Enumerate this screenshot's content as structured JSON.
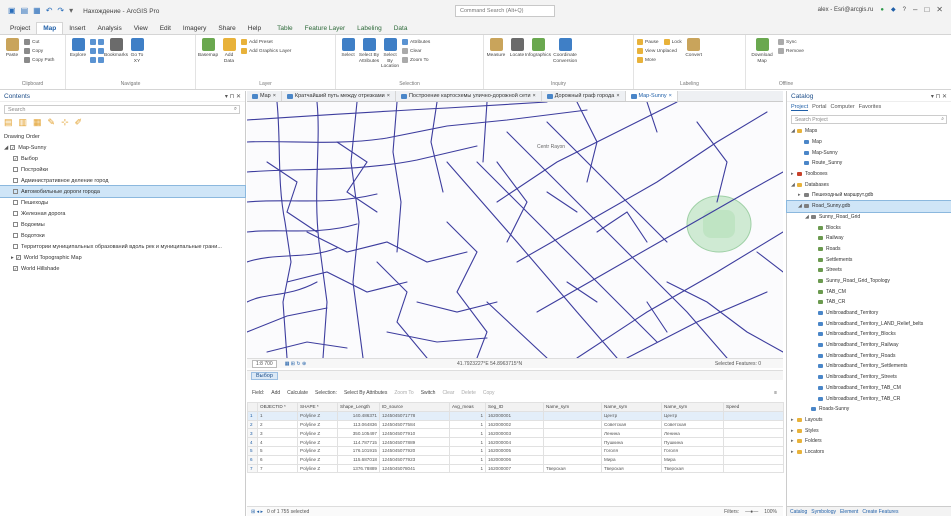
{
  "title_bar": {
    "app_title": "Нахождение - ArcGIS Pro",
    "command_search_placeholder": "Command Search (Alt+Q)",
    "user": "alex - Esri@arcgis.ru",
    "qat_icons": [
      "new-icon",
      "open-icon",
      "save-icon",
      "undo-icon",
      "redo-icon"
    ]
  },
  "ribbon_tabs": [
    {
      "label": "Project",
      "active": false,
      "contextual": false
    },
    {
      "label": "Map",
      "active": true,
      "contextual": false
    },
    {
      "label": "Insert",
      "active": false,
      "contextual": false
    },
    {
      "label": "Analysis",
      "active": false,
      "contextual": false
    },
    {
      "label": "View",
      "active": false,
      "contextual": false
    },
    {
      "label": "Edit",
      "active": false,
      "contextual": false
    },
    {
      "label": "Imagery",
      "active": false,
      "contextual": false
    },
    {
      "label": "Share",
      "active": false,
      "contextual": false
    },
    {
      "label": "Help",
      "active": false,
      "contextual": false
    },
    {
      "label": "Table",
      "active": false,
      "contextual": true
    },
    {
      "label": "Feature Layer",
      "active": false,
      "contextual": true
    },
    {
      "label": "Labeling",
      "active": false,
      "contextual": true
    },
    {
      "label": "Data",
      "active": false,
      "contextual": true
    }
  ],
  "ribbon": {
    "clipboard": {
      "label": "Clipboard",
      "paste": "Paste",
      "cut": "Cut",
      "copy": "Copy",
      "copy_path": "Copy Path"
    },
    "navigate": {
      "label": "Navigate",
      "explore": "Explore",
      "bookmarks": "Bookmarks",
      "go_to_xy": "Go To XY"
    },
    "layer": {
      "label": "Layer",
      "basemap": "Basemap",
      "add_data": "Add Data",
      "add_preset": "Add Preset",
      "add_graphics": "Add Graphics Layer"
    },
    "selection": {
      "label": "Selection",
      "select": "Select",
      "by_attributes": "Select By Attributes",
      "by_location": "Select By Location",
      "attributes": "Attributes",
      "clear": "Clear",
      "zoom_to": "Zoom To"
    },
    "inquiry": {
      "label": "Inquiry",
      "measure": "Measure",
      "locate": "Locate",
      "infographics": "Infographics",
      "coord_conv": "Coordinate Conversion"
    },
    "labeling": {
      "label": "Labeling",
      "pause": "Pause",
      "lock": "Lock",
      "view_unplaced": "View Unplaced",
      "more": "More",
      "convert": "Convert"
    },
    "offline": {
      "label": "Offline",
      "download_map": "Download Map",
      "sync": "Sync",
      "remove": "Remove"
    }
  },
  "contents": {
    "title": "Contents",
    "search_placeholder": "Search",
    "drawing_order": "Drawing Order",
    "layers": [
      {
        "label": "Map-Sunny",
        "checked": true,
        "indent": 0,
        "expander": "◢",
        "selected": false
      },
      {
        "label": "Выбор",
        "checked": true,
        "indent": 1,
        "expander": "",
        "selected": false
      },
      {
        "label": "Постройки",
        "checked": false,
        "indent": 1,
        "expander": "",
        "selected": false
      },
      {
        "label": "Административное деление город",
        "checked": false,
        "indent": 1,
        "expander": "",
        "selected": false
      },
      {
        "label": "Автомобильные дороги города",
        "checked": false,
        "indent": 1,
        "expander": "",
        "selected": true
      },
      {
        "label": "Пешеходы",
        "checked": false,
        "indent": 1,
        "expander": "",
        "selected": false
      },
      {
        "label": "Железная дорога",
        "checked": false,
        "indent": 1,
        "expander": "",
        "selected": false
      },
      {
        "label": "Водоемы",
        "checked": false,
        "indent": 1,
        "expander": "",
        "selected": false
      },
      {
        "label": "Водотоки",
        "checked": false,
        "indent": 1,
        "expander": "",
        "selected": false
      },
      {
        "label": "Территории муниципальных образований вдоль рек и муниципальные грани...",
        "checked": false,
        "indent": 1,
        "expander": "",
        "selected": false
      },
      {
        "label": "World Topographic Map",
        "checked": true,
        "indent": 1,
        "expander": "▸",
        "selected": false
      },
      {
        "label": "World Hillshade",
        "checked": true,
        "indent": 1,
        "expander": "",
        "selected": false
      }
    ]
  },
  "map_tabs": [
    {
      "label": "Map",
      "active": false
    },
    {
      "label": "Кратчайший путь между отрезками",
      "active": false
    },
    {
      "label": "Построение картосхемы улично-дорожной сети",
      "active": false
    },
    {
      "label": "Дорожный граф города",
      "active": false
    },
    {
      "label": "Map-Sunny",
      "active": true
    }
  ],
  "map": {
    "district_label": "Centr Rayon",
    "scale": "1:8 700",
    "coordinates": "41.7923227°E 54.8963715°N",
    "selected_features": "Selected Features: 0",
    "road_color": "#3d3d9e",
    "stadium_color": "#bfe4c3"
  },
  "attribute_table": {
    "tab_label": "Выбор",
    "toolbar": {
      "field": "Field:",
      "add": "Add",
      "calculate": "Calculate",
      "selection": "Selection:",
      "select_by_attr": "Select By Attributes",
      "zoom_to": "Zoom To",
      "switch": "Switch",
      "clear": "Clear",
      "delete": "Delete",
      "copy": "Copy"
    },
    "columns": [
      "",
      "OBJECTID *",
      "SHAPE *",
      "Shape_Length",
      "ID_source",
      "Avg_meas",
      "Seg_ID",
      "Name_sym",
      "Name_sym",
      "Name_sym",
      "Speed"
    ],
    "rows": [
      [
        "1",
        "1",
        "Polyline Z",
        "140.486371",
        "1245045071778",
        "1",
        "162000001",
        "",
        "Центр",
        "Центр",
        ""
      ],
      [
        "2",
        "2",
        "Polyline Z",
        "113.064836",
        "1245045077584",
        "1",
        "162000002",
        "",
        "Советская",
        "Советская",
        ""
      ],
      [
        "3",
        "3",
        "Polyline Z",
        "350.105497",
        "1245045077910",
        "1",
        "162000003",
        "",
        "Ленина",
        "Ленина",
        ""
      ],
      [
        "4",
        "4",
        "Polyline Z",
        "114.787715",
        "1245045077889",
        "1",
        "162000004",
        "",
        "Пушкина",
        "Пушкина",
        ""
      ],
      [
        "5",
        "5",
        "Polyline Z",
        "176.101915",
        "1245045077920",
        "1",
        "162000005",
        "",
        "Гоголя",
        "Гоголя",
        ""
      ],
      [
        "6",
        "6",
        "Polyline Z",
        "115.687018",
        "1245045077923",
        "1",
        "162000006",
        "",
        "Мира",
        "Мира",
        ""
      ],
      [
        "7",
        "7",
        "Polyline Z",
        "1376.78889",
        "1245045078041",
        "1",
        "162000007",
        "Тверская",
        "Тверская",
        "Тверская",
        ""
      ]
    ],
    "status": "0 of 1 755 selected",
    "filters": "Filters:",
    "zoom_pct": "100%"
  },
  "catalog": {
    "title": "Catalog",
    "tabs": [
      "Project",
      "Portal",
      "Computer",
      "Favorites"
    ],
    "search_placeholder": "Search Project",
    "items": [
      {
        "label": "Maps",
        "indent": 0,
        "expander": "◢",
        "icon": "#e8b23a",
        "selected": false
      },
      {
        "label": "Map",
        "indent": 1,
        "expander": "",
        "icon": "#4a86c8",
        "selected": false
      },
      {
        "label": "Map-Sunny",
        "indent": 1,
        "expander": "",
        "icon": "#4a86c8",
        "selected": false
      },
      {
        "label": "Route_Sunny",
        "indent": 1,
        "expander": "",
        "icon": "#4a86c8",
        "selected": false
      },
      {
        "label": "Toolboxes",
        "indent": 0,
        "expander": "▸",
        "icon": "#c7412a",
        "selected": false
      },
      {
        "label": "Databases",
        "indent": 0,
        "expander": "◢",
        "icon": "#e8b23a",
        "selected": false
      },
      {
        "label": "Пешеходный маршрут.gdb",
        "indent": 1,
        "expander": "▸",
        "icon": "#7f7f7f",
        "selected": false
      },
      {
        "label": "Road_Sunny.gdb",
        "indent": 1,
        "expander": "◢",
        "icon": "#7f7f7f",
        "selected": true
      },
      {
        "label": "Sunny_Road_Grid",
        "indent": 2,
        "expander": "◢",
        "icon": "#7f7f7f",
        "selected": false
      },
      {
        "label": "Blocks",
        "indent": 3,
        "expander": "",
        "icon": "#6b9a4f",
        "selected": false
      },
      {
        "label": "Railway",
        "indent": 3,
        "expander": "",
        "icon": "#6b9a4f",
        "selected": false
      },
      {
        "label": "Roads",
        "indent": 3,
        "expander": "",
        "icon": "#6b9a4f",
        "selected": false
      },
      {
        "label": "Settlements",
        "indent": 3,
        "expander": "",
        "icon": "#6b9a4f",
        "selected": false
      },
      {
        "label": "Streets",
        "indent": 3,
        "expander": "",
        "icon": "#6b9a4f",
        "selected": false
      },
      {
        "label": "Sunny_Road_Grid_Topology",
        "indent": 3,
        "expander": "",
        "icon": "#6b9a4f",
        "selected": false
      },
      {
        "label": "TAB_CM",
        "indent": 3,
        "expander": "",
        "icon": "#6b9a4f",
        "selected": false
      },
      {
        "label": "TAB_CR",
        "indent": 3,
        "expander": "",
        "icon": "#6b9a4f",
        "selected": false
      },
      {
        "label": "Unibroadband_Territory",
        "indent": 3,
        "expander": "",
        "icon": "#4a86c8",
        "selected": false
      },
      {
        "label": "Unibroadband_Territory_LAND_Relief_belts",
        "indent": 3,
        "expander": "",
        "icon": "#4a86c8",
        "selected": false
      },
      {
        "label": "Unibroadband_Territory_Blocks",
        "indent": 3,
        "expander": "",
        "icon": "#4a86c8",
        "selected": false
      },
      {
        "label": "Unibroadband_Territory_Railway",
        "indent": 3,
        "expander": "",
        "icon": "#4a86c8",
        "selected": false
      },
      {
        "label": "Unibroadband_Territory_Roads",
        "indent": 3,
        "expander": "",
        "icon": "#4a86c8",
        "selected": false
      },
      {
        "label": "Unibroadband_Territory_Settlements",
        "indent": 3,
        "expander": "",
        "icon": "#4a86c8",
        "selected": false
      },
      {
        "label": "Unibroadband_Territory_Streets",
        "indent": 3,
        "expander": "",
        "icon": "#4a86c8",
        "selected": false
      },
      {
        "label": "Unibroadband_Territory_TAB_CM",
        "indent": 3,
        "expander": "",
        "icon": "#4a86c8",
        "selected": false
      },
      {
        "label": "Unibroadband_Territory_TAB_CR",
        "indent": 3,
        "expander": "",
        "icon": "#4a86c8",
        "selected": false
      },
      {
        "label": "Roads-Sunny",
        "indent": 2,
        "expander": "",
        "icon": "#4a86c8",
        "selected": false
      },
      {
        "label": "Layouts",
        "indent": 0,
        "expander": "▸",
        "icon": "#e8b23a",
        "selected": false
      },
      {
        "label": "Styles",
        "indent": 0,
        "expander": "▸",
        "icon": "#e8b23a",
        "selected": false
      },
      {
        "label": "Folders",
        "indent": 0,
        "expander": "▸",
        "icon": "#e8b23a",
        "selected": false
      },
      {
        "label": "Locators",
        "indent": 0,
        "expander": "▸",
        "icon": "#e8b23a",
        "selected": false
      }
    ],
    "bottom_tabs": [
      "Catalog",
      "Symbology",
      "Element",
      "Create Features"
    ]
  }
}
